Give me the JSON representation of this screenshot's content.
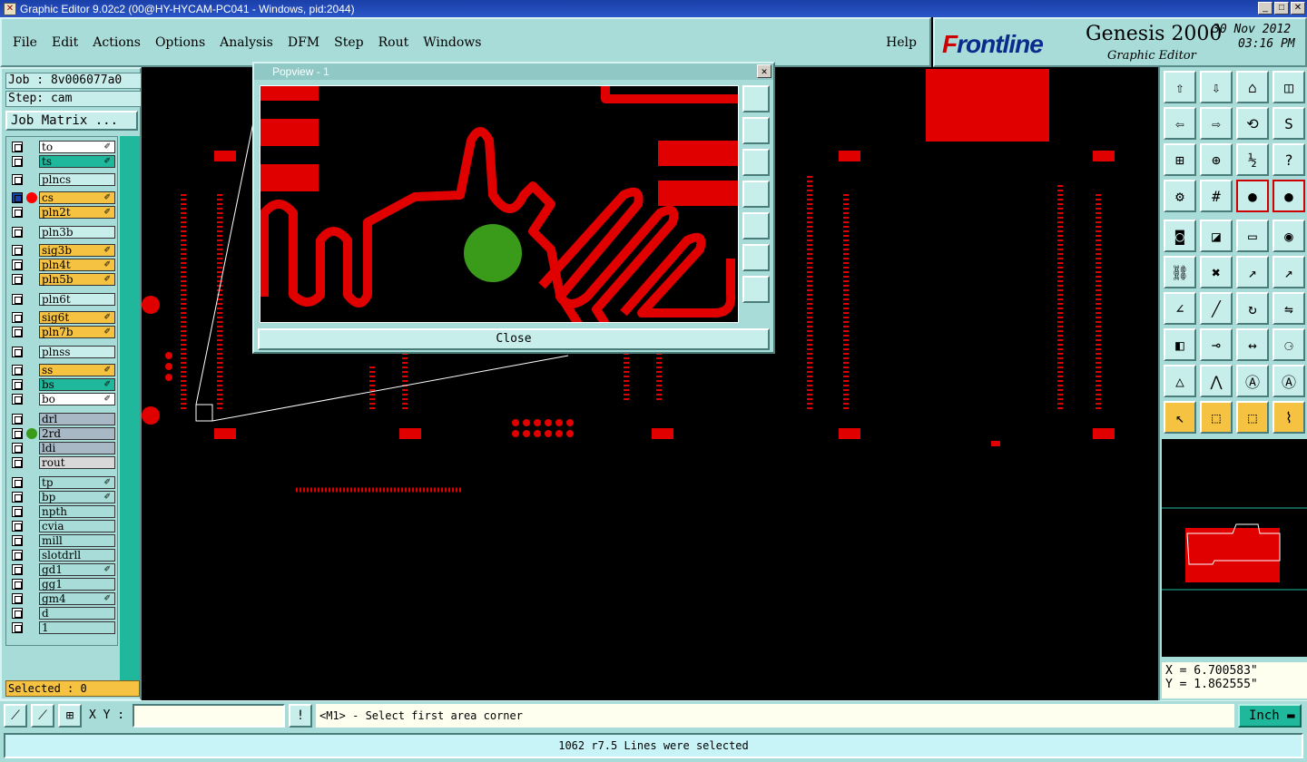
{
  "window": {
    "title": "Graphic Editor 9.02c2 (00@HY-HYCAM-PC041 - Windows, pid:2044)"
  },
  "menu": [
    "File",
    "Edit",
    "Actions",
    "Options",
    "Analysis",
    "DFM",
    "Step",
    "Rout",
    "Windows"
  ],
  "help_label": "Help",
  "brand": {
    "logo_prefix": "F",
    "logo_rest": "rontline",
    "product": "Genesis 2000",
    "subtitle": "Graphic Editor",
    "date": "30 Nov 2012",
    "time": "03:16 PM"
  },
  "job": {
    "job_label": "Job : 8v006077a0",
    "step_label": "Step: cam",
    "matrix_label": "Job Matrix ..."
  },
  "layers": [
    {
      "name": "to",
      "color": "#ffffff",
      "edit": "✐"
    },
    {
      "name": "ts",
      "color": "#1fb89c",
      "edit": "✐"
    },
    {
      "name": "plncs",
      "color": "#c8eeec",
      "edit": ""
    },
    {
      "name": "cs",
      "color": "#f5c242",
      "edit": "✐",
      "active": true,
      "dot": "#ff0000"
    },
    {
      "name": "pln2t",
      "color": "#f5c242",
      "edit": "✐"
    },
    {
      "name": "pln3b",
      "color": "#c8eeec",
      "edit": ""
    },
    {
      "name": "sig3b",
      "color": "#f5c242",
      "edit": "✐"
    },
    {
      "name": "pln4t",
      "color": "#f5c242",
      "edit": "✐"
    },
    {
      "name": "pln5b",
      "color": "#f5c242",
      "edit": "✐"
    },
    {
      "name": "pln6t",
      "color": "#c8eeec",
      "edit": ""
    },
    {
      "name": "sig6t",
      "color": "#f5c242",
      "edit": "✐"
    },
    {
      "name": "pln7b",
      "color": "#f5c242",
      "edit": "✐"
    },
    {
      "name": "plnss",
      "color": "#c8eeec",
      "edit": ""
    },
    {
      "name": "ss",
      "color": "#f5c242",
      "edit": "✐"
    },
    {
      "name": "bs",
      "color": "#1fb89c",
      "edit": "✐"
    },
    {
      "name": "bo",
      "color": "#ffffff",
      "edit": "✐"
    },
    {
      "name": "drl",
      "color": "#a8b8c4",
      "edit": ""
    },
    {
      "name": "2rd",
      "color": "#a8b8c4",
      "edit": "",
      "dot": "#3a9a1a"
    },
    {
      "name": "ldi",
      "color": "#a8b8c4",
      "edit": ""
    },
    {
      "name": "rout",
      "color": "#d8d8d8",
      "edit": ""
    },
    {
      "name": "tp",
      "color": "#a8dcd8",
      "edit": "✐"
    },
    {
      "name": "bp",
      "color": "#a8dcd8",
      "edit": "✐"
    },
    {
      "name": "npth",
      "color": "#a8dcd8",
      "edit": ""
    },
    {
      "name": "cvia",
      "color": "#a8dcd8",
      "edit": ""
    },
    {
      "name": "mill",
      "color": "#a8dcd8",
      "edit": ""
    },
    {
      "name": "slotdrll",
      "color": "#a8dcd8",
      "edit": ""
    },
    {
      "name": "gd1",
      "color": "#a8dcd8",
      "edit": "✐"
    },
    {
      "name": "gg1",
      "color": "#a8dcd8",
      "edit": ""
    },
    {
      "name": "gm4",
      "color": "#a8dcd8",
      "edit": "✐"
    },
    {
      "name": "d",
      "color": "#a8dcd8",
      "edit": ""
    },
    {
      "name": "1",
      "color": "#a8dcd8",
      "edit": ""
    }
  ],
  "selected_label": "Selected : 0",
  "popview": {
    "title": "Popview - 1",
    "close_label": "Close"
  },
  "coords": {
    "x_label": "X = 6.700583\"",
    "y_label": "Y = 1.862555\""
  },
  "command": {
    "xy_label": "X Y :",
    "xy_value": "",
    "prompt": "<M1> - Select first area corner",
    "unit": "Inch"
  },
  "status": {
    "message": "1062 r7.5 Lines were selected"
  }
}
